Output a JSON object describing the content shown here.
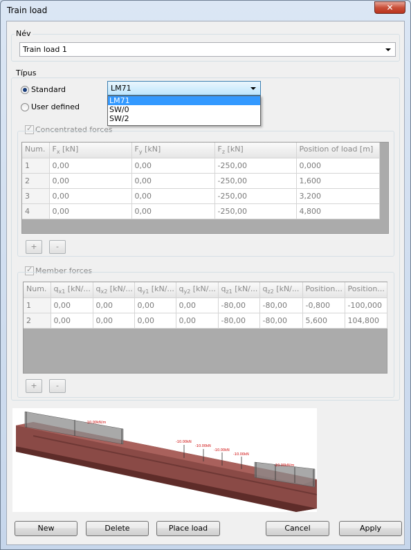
{
  "window": {
    "title": "Train load",
    "close_glyph": "✕"
  },
  "name_group": {
    "label": "Név",
    "value": "Train load 1"
  },
  "type_group": {
    "label": "Típus",
    "standard_label": "Standard",
    "user_defined_label": "User defined",
    "selected_option": "LM71",
    "options": [
      "LM71",
      "SW/0",
      "SW/2"
    ]
  },
  "concentrated": {
    "label": "Concentrated forces",
    "columns": [
      {
        "base": "Num.",
        "sub": "",
        "rest": ""
      },
      {
        "base": "F",
        "sub": "x",
        "rest": " [kN]"
      },
      {
        "base": "F",
        "sub": "y",
        "rest": " [kN]"
      },
      {
        "base": "F",
        "sub": "z",
        "rest": " [kN]"
      },
      {
        "base": "Position of load [m]",
        "sub": "",
        "rest": ""
      }
    ],
    "rows": [
      [
        "1",
        "0,00",
        "0,00",
        "-250,00",
        "0,000"
      ],
      [
        "2",
        "0,00",
        "0,00",
        "-250,00",
        "1,600"
      ],
      [
        "3",
        "0,00",
        "0,00",
        "-250,00",
        "3,200"
      ],
      [
        "4",
        "0,00",
        "0,00",
        "-250,00",
        "4,800"
      ]
    ]
  },
  "member": {
    "label": "Member forces",
    "columns": [
      {
        "base": "Num.",
        "sub": "",
        "rest": ""
      },
      {
        "base": "q",
        "sub": "x1",
        "rest": " [kN/..."
      },
      {
        "base": "q",
        "sub": "x2",
        "rest": " [kN/..."
      },
      {
        "base": "q",
        "sub": "y1",
        "rest": " [kN/..."
      },
      {
        "base": "q",
        "sub": "y2",
        "rest": " [kN/..."
      },
      {
        "base": "q",
        "sub": "z1",
        "rest": " [kN/..."
      },
      {
        "base": "q",
        "sub": "z2",
        "rest": " [kN/..."
      },
      {
        "base": "Position...",
        "sub": "",
        "rest": ""
      },
      {
        "base": "Position...",
        "sub": "",
        "rest": ""
      }
    ],
    "rows": [
      [
        "1",
        "0,00",
        "0,00",
        "0,00",
        "0,00",
        "-80,00",
        "-80,00",
        "-0,800",
        "-100,000"
      ],
      [
        "2",
        "0,00",
        "0,00",
        "0,00",
        "0,00",
        "-80,00",
        "-80,00",
        "5,600",
        "104,800"
      ]
    ]
  },
  "grid_buttons": {
    "add": "+",
    "remove": "-"
  },
  "preview": {
    "distributed_label": "-10.00kN/m",
    "point_label": "-10.00kN",
    "colors": {
      "beam": "#8a4a46",
      "beam_dark": "#5e2c29",
      "load_patch": "#8c8c8c",
      "label": "#cc0000"
    }
  },
  "buttons": {
    "new": "New",
    "delete": "Delete",
    "place_load": "Place load",
    "cancel": "Cancel",
    "apply": "Apply"
  },
  "colors": {
    "accent": "#3399ff",
    "close": "#c9503a"
  }
}
